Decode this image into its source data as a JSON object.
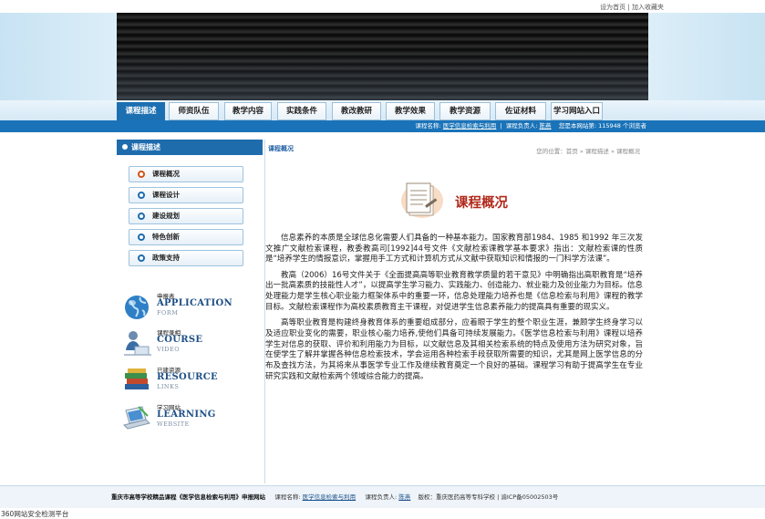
{
  "header": {
    "set_home": "设为首页",
    "divider": "|",
    "add_favorite": "加入收藏夹"
  },
  "nav": {
    "tabs": [
      {
        "label": "课程描述",
        "active": true
      },
      {
        "label": "师资队伍"
      },
      {
        "label": "教学内容"
      },
      {
        "label": "实践条件"
      },
      {
        "label": "教改教研"
      },
      {
        "label": "教学效果"
      },
      {
        "label": "教学资源"
      },
      {
        "label": "佐证材料"
      },
      {
        "label": "学习网站入口"
      }
    ]
  },
  "infobar": {
    "course_label": "课程名称:",
    "course_name": "医学信息检索与利用",
    "owner_label": "课程负责人:",
    "owner_name": "陈燕",
    "visitor_label": "您是本网站第:",
    "visitor_count": "115948",
    "visitor_suffix": "个浏览者"
  },
  "sidebar": {
    "title": "课程描述",
    "menu": [
      {
        "label": "课程概况",
        "highlight": true
      },
      {
        "label": "课程设计"
      },
      {
        "label": "建设规划"
      },
      {
        "label": "特色创新"
      },
      {
        "label": "政策支持"
      }
    ],
    "promos": [
      {
        "zh": "申报表",
        "en": "APPLICATION",
        "sub": "FORM",
        "icon": "globe-icon"
      },
      {
        "zh": "课程录相",
        "en": "COURSE",
        "sub": "VIDEO",
        "icon": "student-icon"
      },
      {
        "zh": "已建资源",
        "en": "RESOURCE",
        "sub": "LINKS",
        "icon": "books-icon"
      },
      {
        "zh": "学习网站",
        "en": "LEARNING",
        "sub": "WEBSITE",
        "icon": "laptop-icon"
      }
    ]
  },
  "main": {
    "crumb_left": "课程概况",
    "crumb_right": "您的位置：首页 » 课程描述 » 课程概况",
    "title": "课程概况",
    "paragraphs": [
      "信息素养的本质是全球信息化需要人们具备的一种基本能力。国家教育部1984、1985 和1992 年三次发文推广文献检索课程，教委教高司[1992]44号文件《文献检索课教学基本要求》指出：文献检索课的性质是“培养学生的情报意识，掌握用手工方式和计算机方式从文献中获取知识和情报的一门科学方法课”。",
      "教高（2006）16号文件关于《全面提高高等职业教育教学质量的若干意见》中明确指出高职教育是“培养出一批高素质的技能性人才”，以提高学生学习能力、实践能力、创造能力、就业能力及创业能力为目标。信息处理能力是学生核心职业能力框架体系中的重要一环，信息处理能力培养也是《信息检索与利用》课程的教学目标。文献检索课程作为高校素质教育主干课程，对促进学生信息素养能力的提高具有重要的现实义。",
      "高等职业教育是构建终身教育体系的重要组成部分，应着眼于学生的整个职业生涯，兼顾学生终身学习以及适应职业变化的需要，职业核心能力培养,使他们具备可持续发展能力。《医学信息检索与利用》课程以培养学生对信息的获取、评价和利用能力为目标，以文献信息及其相关检索系统的特点及使用方法为研究对象，旨在使学生了解并掌握各种信息检索技术，学会运用各种检索手段获取所需要的知识，尤其是网上医学信息的分布及查找方法，为其将来从事医学专业工作及继续教育奠定一个良好的基础。课程学习有助于提高学生在专业研究实践和文献检索两个领域综合能力的提高。"
    ]
  },
  "footer": {
    "site": "重庆市高等学校精品课程《医学信息检索与利用》申报网站",
    "course_label": "课程名称:",
    "course_name": "医学信息检索与利用",
    "owner_label": "课程负责人:",
    "owner_name": "陈燕",
    "rights": "版权：重庆医药高等专科学校 | 渝ICP备05002503号"
  },
  "bottom_note": "360网站安全检测平台",
  "colors": {
    "primary": "#1a73b8",
    "active_tab": "#1c6fb1",
    "title_red": "#b12a1c",
    "menu_dot_hot": "#d2541c"
  }
}
